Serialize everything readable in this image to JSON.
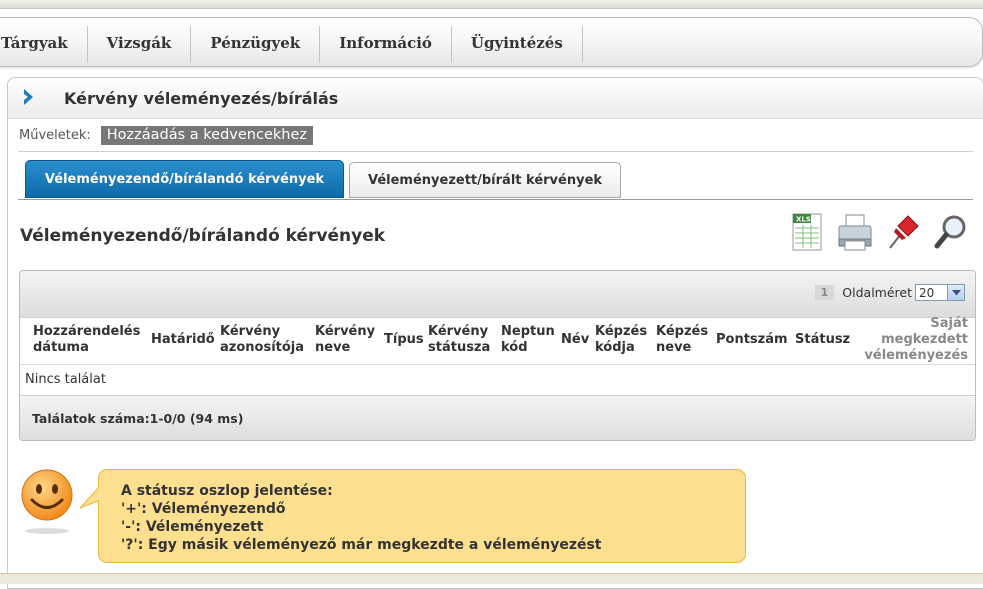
{
  "menu": [
    "Tárgyak",
    "Vizsgák",
    "Pénzügyek",
    "Információ",
    "Ügyintézés"
  ],
  "panel": {
    "title": "Kérvény véleményezés/bírálás",
    "ops_label": "Műveletek:",
    "fav_button": "Hozzáadás a kedvencekhez"
  },
  "tabs": {
    "active": "Véleményezendő/bírálandó kérvények",
    "inactive": "Véleményezett/bírált kérvények"
  },
  "section_title": "Véleményezendő/bírálandó kérvények",
  "icons": [
    "xls-export-icon",
    "print-icon",
    "pin-icon",
    "search-magnifier-icon"
  ],
  "grid": {
    "page": "1",
    "page_size_label": "Oldalméret",
    "page_size": "20",
    "columns": [
      "Hozzárendelés dátuma",
      "Határidő",
      "Kérvény azonosítója",
      "Kérvény neve",
      "Típus",
      "Kérvény státusza",
      "Neptun kód",
      "Név",
      "Képzés kódja",
      "Képzés neve",
      "Pontszám",
      "Státusz",
      "Saját megkezdett véleményezés"
    ],
    "empty": "Nincs találat",
    "footer": "Találatok száma:1-0/0 (94 ms)"
  },
  "help": {
    "title": "A státusz oszlop jelentése:",
    "lines": [
      "'+': Véleményezendő",
      "'-': Véleményezett",
      "'?': Egy másik véleményező már megkezdte a véleményezést"
    ]
  },
  "colors": {
    "accent": "#1a7bbd",
    "bubble": "#fddf90",
    "fav_bg": "#777777"
  }
}
